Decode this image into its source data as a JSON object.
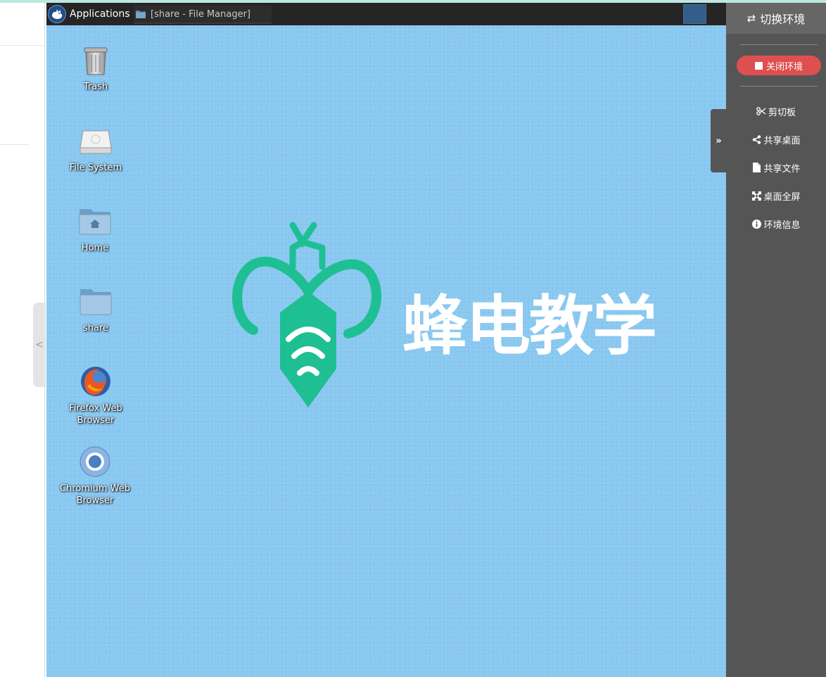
{
  "desktop_panel": {
    "applications_label": "Applications",
    "task_window_label": "[share - File Manager]"
  },
  "desktop_icons": [
    {
      "label": "Trash",
      "icon": "trash-icon"
    },
    {
      "label": "File System",
      "icon": "drive-icon"
    },
    {
      "label": "Home",
      "icon": "home-folder-icon"
    },
    {
      "label": "share",
      "icon": "folder-icon"
    },
    {
      "label": "Firefox Web Browser",
      "icon": "firefox-icon"
    },
    {
      "label": "Chromium Web Browser",
      "icon": "chromium-icon"
    }
  ],
  "wallpaper": {
    "brand_text": "蜂电教学",
    "background_color": "#89c8f0",
    "logo_color": "#1fbf94"
  },
  "toolbar": {
    "switch_env_label": "切换环境",
    "close_env_label": "关闭环境",
    "items": [
      {
        "label": "剪切板",
        "icon": "scissors-icon"
      },
      {
        "label": "共享桌面",
        "icon": "share-icon"
      },
      {
        "label": "共享文件",
        "icon": "file-icon"
      },
      {
        "label": "桌面全屏",
        "icon": "fullscreen-icon"
      },
      {
        "label": "环境信息",
        "icon": "info-icon"
      }
    ],
    "close_color": "#de4f4f",
    "panel_color": "#555555"
  },
  "left_panel": {
    "collapse_glyph": "<"
  }
}
